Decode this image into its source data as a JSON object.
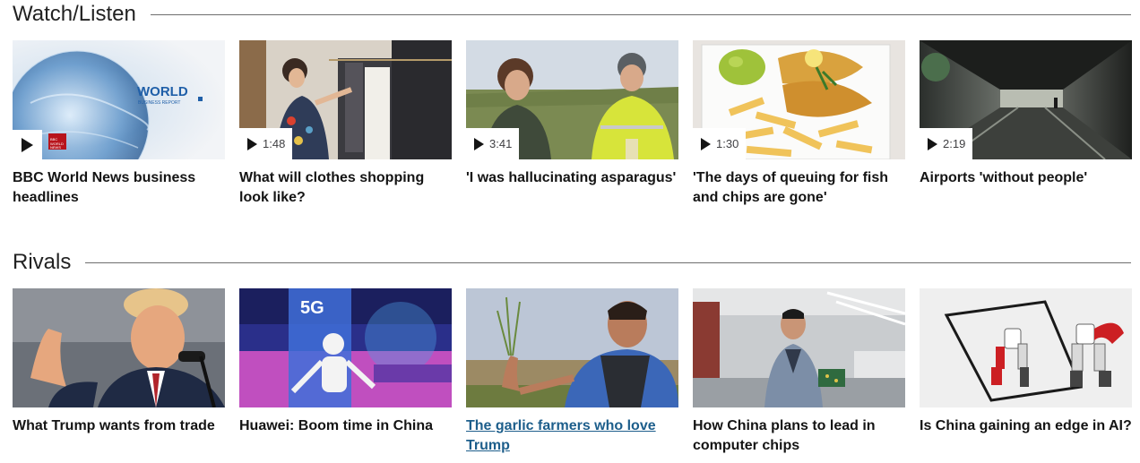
{
  "watch": {
    "heading": "Watch/Listen",
    "items": [
      {
        "title": "BBC World News business headlines",
        "duration": "",
        "thumb_text_1": "WORLD",
        "thumb_text_2": "BUSINESS REPORT",
        "thumb_badge": "BBC WORLD NEWS"
      },
      {
        "title": "What will clothes shopping look like?",
        "duration": "1:48"
      },
      {
        "title": "'I was hallucinating asparagus'",
        "duration": "3:41"
      },
      {
        "title": "'The days of queuing for fish and chips are gone'",
        "duration": "1:30"
      },
      {
        "title": "Airports 'without people'",
        "duration": "2:19"
      }
    ]
  },
  "rivals": {
    "heading": "Rivals",
    "items": [
      {
        "title": "What Trump wants from trade"
      },
      {
        "title": "Huawei: Boom time in China",
        "thumb_text": "5G"
      },
      {
        "title": "The garlic farmers who love Trump"
      },
      {
        "title": "How China plans to lead in computer chips"
      },
      {
        "title": "Is China gaining an edge in AI?"
      }
    ]
  },
  "icons": {
    "play": "play-icon"
  },
  "colors": {
    "link": "#1d5e8b",
    "rule": "#6e6e6e",
    "text": "#141414"
  }
}
